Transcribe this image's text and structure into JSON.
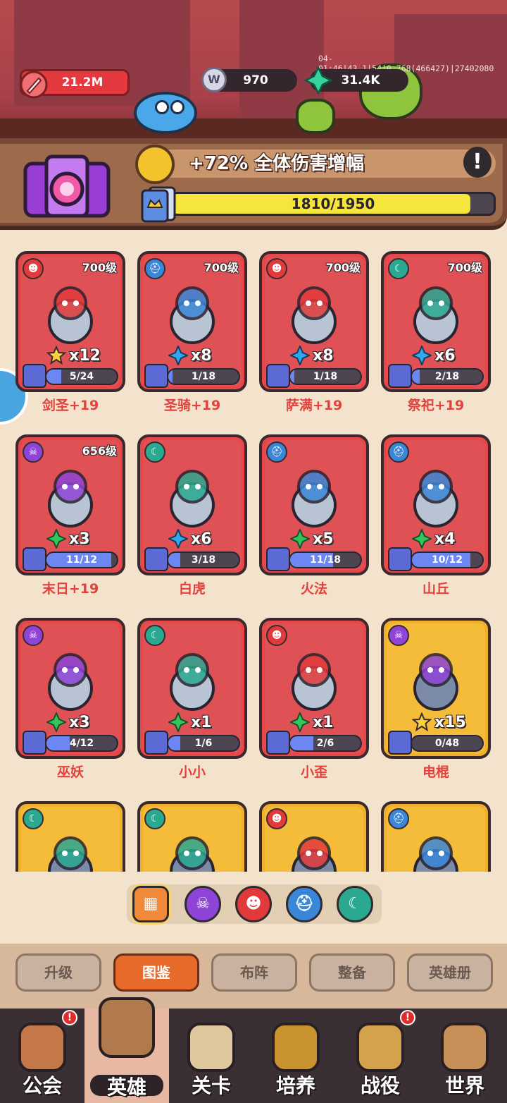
{
  "top": {
    "power": "21.2M",
    "coins": "970",
    "coin_icon": "W",
    "gems": "31.4K",
    "debug": "04-01:46|43,1|54|0.768(466427)|27402080"
  },
  "bonus": {
    "text": "+72% 全体伤害增幅",
    "info": "!",
    "progress_label": "1810/1950",
    "progress_fraction": 0.928
  },
  "colors": {
    "red_card": "#e8474a",
    "gold_card": "#f0b02c",
    "skull": "#8e44d6",
    "demon": "#e23a3a",
    "helmet": "#3a86d8",
    "moon": "#2aa890"
  },
  "heroes": [
    {
      "name": "剑圣+19",
      "level": "700级",
      "class": "demon",
      "mult_icon": "star-icon",
      "mult": "x12",
      "frag": "5/24",
      "frag_fraction": 0.21,
      "gold": false
    },
    {
      "name": "圣骑+19",
      "level": "700级",
      "class": "helmet",
      "mult_icon": "blue-diamond-icon",
      "mult": "x8",
      "frag": "1/18",
      "frag_fraction": 0.06,
      "gold": false
    },
    {
      "name": "萨满+19",
      "level": "700级",
      "class": "demon",
      "mult_icon": "blue-diamond-icon",
      "mult": "x8",
      "frag": "1/18",
      "frag_fraction": 0.06,
      "gold": false
    },
    {
      "name": "祭祀+19",
      "level": "700级",
      "class": "moon",
      "mult_icon": "blue-diamond-icon",
      "mult": "x6",
      "frag": "2/18",
      "frag_fraction": 0.11,
      "gold": false
    },
    {
      "name": "末日+19",
      "level": "656级",
      "class": "skull",
      "mult_icon": "green-diamond-icon",
      "mult": "x3",
      "frag": "11/12",
      "frag_fraction": 0.92,
      "gold": false
    },
    {
      "name": "白虎",
      "level": "",
      "class": "moon",
      "mult_icon": "blue-diamond-icon",
      "mult": "x6",
      "frag": "3/18",
      "frag_fraction": 0.17,
      "gold": false
    },
    {
      "name": "火法",
      "level": "",
      "class": "helmet",
      "mult_icon": "green-diamond-icon",
      "mult": "x5",
      "frag": "11/18",
      "frag_fraction": 0.61,
      "gold": false
    },
    {
      "name": "山丘",
      "level": "",
      "class": "helmet",
      "mult_icon": "green-diamond-icon",
      "mult": "x4",
      "frag": "10/12",
      "frag_fraction": 0.83,
      "gold": false
    },
    {
      "name": "巫妖",
      "level": "",
      "class": "skull",
      "mult_icon": "green-diamond-icon",
      "mult": "x3",
      "frag": "4/12",
      "frag_fraction": 0.33,
      "gold": false
    },
    {
      "name": "小小",
      "level": "",
      "class": "moon",
      "mult_icon": "green-diamond-icon",
      "mult": "x1",
      "frag": "1/6",
      "frag_fraction": 0.17,
      "gold": false
    },
    {
      "name": "小歪",
      "level": "",
      "class": "demon",
      "mult_icon": "green-diamond-icon",
      "mult": "x1",
      "frag": "2/6",
      "frag_fraction": 0.33,
      "gold": false
    },
    {
      "name": "电棍",
      "level": "",
      "class": "skull",
      "mult_icon": "star-icon",
      "mult": "x15",
      "frag": "0/48",
      "frag_fraction": 0.0,
      "gold": true
    },
    {
      "name": "",
      "level": "",
      "class": "moon",
      "mult_icon": "",
      "mult": "",
      "frag": "",
      "frag_fraction": 0,
      "gold": true
    },
    {
      "name": "",
      "level": "",
      "class": "moon",
      "mult_icon": "",
      "mult": "",
      "frag": "",
      "frag_fraction": 0,
      "gold": true
    },
    {
      "name": "",
      "level": "",
      "class": "demon",
      "mult_icon": "",
      "mult": "",
      "frag": "",
      "frag_fraction": 0,
      "gold": true
    },
    {
      "name": "",
      "level": "",
      "class": "helmet",
      "mult_icon": "",
      "mult": "",
      "frag": "",
      "frag_fraction": 0,
      "gold": true
    }
  ],
  "filters": [
    "all",
    "skull",
    "demon",
    "helmet",
    "moon"
  ],
  "filter_selected": "all",
  "subtabs": [
    "升级",
    "图鉴",
    "布阵",
    "整备",
    "英雄册"
  ],
  "subtab_active": "图鉴",
  "nav": [
    {
      "label": "公会",
      "icon": "guild-crown-icon",
      "badge": "!",
      "color": "#c4784a"
    },
    {
      "label": "英雄",
      "icon": "hero-portal-icon",
      "badge": "",
      "color": "#b07a4e",
      "active": true
    },
    {
      "label": "关卡",
      "icon": "sword-icon",
      "badge": "",
      "color": "#e0c89e"
    },
    {
      "label": "培养",
      "icon": "cultivate-icon",
      "badge": "",
      "color": "#c8922e"
    },
    {
      "label": "战役",
      "icon": "campaign-icon",
      "badge": "!",
      "color": "#d4a24c"
    },
    {
      "label": "世界",
      "icon": "world-icon",
      "badge": "",
      "color": "#c79058"
    }
  ]
}
